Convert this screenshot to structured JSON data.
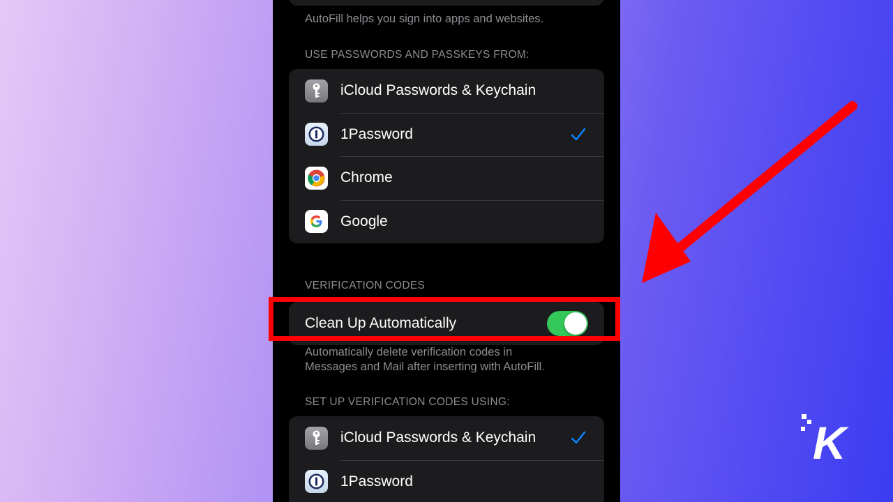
{
  "autofill_footer": "AutoFill helps you sign into apps and websites.",
  "passwords_section": {
    "header": "USE PASSWORDS AND PASSKEYS FROM:",
    "items": [
      {
        "label": "iCloud Passwords & Keychain",
        "icon": "key-icon",
        "checked": false
      },
      {
        "label": "1Password",
        "icon": "onepassword-icon",
        "checked": true
      },
      {
        "label": "Chrome",
        "icon": "chrome-icon",
        "checked": false
      },
      {
        "label": "Google",
        "icon": "google-icon",
        "checked": false
      }
    ]
  },
  "verification_section": {
    "header": "VERIFICATION CODES",
    "toggle_label": "Clean Up Automatically",
    "toggle_on": true,
    "footer_line1": "Automatically delete verification codes in",
    "footer_line2": "Messages and Mail after inserting with AutoFill."
  },
  "setup_section": {
    "header": "SET UP VERIFICATION CODES USING:",
    "items": [
      {
        "label": "iCloud Passwords & Keychain",
        "icon": "key-icon",
        "checked": true
      },
      {
        "label": "1Password",
        "icon": "onepassword-icon",
        "checked": false
      }
    ]
  },
  "colors": {
    "accent_blue": "#0a84ff",
    "toggle_green": "#34c759",
    "annotation_red": "#ff0000"
  },
  "brand_logo_text": "K"
}
